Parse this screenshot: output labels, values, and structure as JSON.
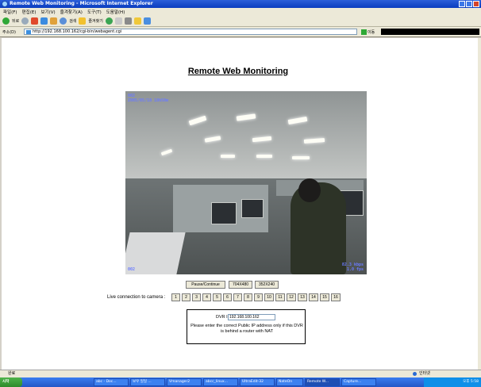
{
  "window": {
    "title": "Remote Web Monitoring - Microsoft Internet Explorer"
  },
  "menu": [
    "파일(F)",
    "편집(E)",
    "보기(V)",
    "즐겨찾기(A)",
    "도구(T)",
    "도움말(H)"
  ],
  "toolbar": {
    "back_label": "뒤로",
    "search_label": "검색",
    "favorites_label": "즐겨찾기"
  },
  "address": {
    "label": "주소(D)",
    "url": "http://192.168.100.162/cgi-bin/webagent.cgi",
    "go_label": "이동"
  },
  "page": {
    "title": "Remote Web Monitoring",
    "osd_top": "002\n2005/05/18 18h58m",
    "osd_bottom": "82.3 kbps\n1.0 fps",
    "osd_left_bottom": "002",
    "buttons": {
      "pause": "Pause/Continue",
      "res1": "704X480",
      "res2": "352X240"
    },
    "live_label": "Live connection to camera :",
    "camera_buttons": [
      "1",
      "2",
      "3",
      "4",
      "5",
      "6",
      "7",
      "8",
      "9",
      "10",
      "11",
      "12",
      "13",
      "14",
      "15",
      "16"
    ],
    "dvr": {
      "label": "DVR IP",
      "value": "192.168.100.162",
      "note": "Please enter the correct Public IP address only if this DVR is behind a router with NAT"
    }
  },
  "status": {
    "left": "완료",
    "zone": "인터넷"
  },
  "taskbar": {
    "start": "시작",
    "tasks": [
      "abc - Doc...",
      "보우 일일 ...",
      "Vmanager2",
      "abcc_linux...",
      "UltraEdit-32",
      "NateOn",
      "Remote W...",
      "Capture..."
    ],
    "tray": "오후 5:58"
  }
}
